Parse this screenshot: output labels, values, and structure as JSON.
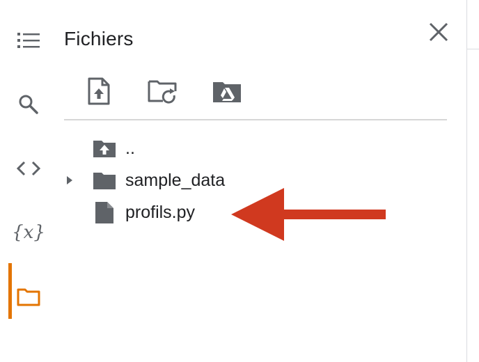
{
  "panel": {
    "title": "Fichiers"
  },
  "sidebar": {
    "items": [
      {
        "name": "table-of-contents",
        "icon": "list-icon"
      },
      {
        "name": "search",
        "icon": "search-icon"
      },
      {
        "name": "code-snippets",
        "icon": "code-icon"
      },
      {
        "name": "variables",
        "icon": "variables-icon",
        "glyph": "{x}"
      },
      {
        "name": "files",
        "icon": "folder-icon",
        "active": true
      }
    ],
    "accent_color": "#e37400"
  },
  "toolbar": {
    "items": [
      {
        "icon": "upload-file-icon"
      },
      {
        "icon": "refresh-folder-icon"
      },
      {
        "icon": "mount-drive-icon"
      }
    ]
  },
  "files": [
    {
      "name": "..",
      "icon": "folder-up-icon",
      "expandable": false
    },
    {
      "name": "sample_data",
      "icon": "folder-icon",
      "expandable": true
    },
    {
      "name": "profils.py",
      "icon": "file-icon",
      "expandable": false
    }
  ],
  "annotation": {
    "arrow_color": "#d0391f",
    "points_to": "profils.py"
  }
}
